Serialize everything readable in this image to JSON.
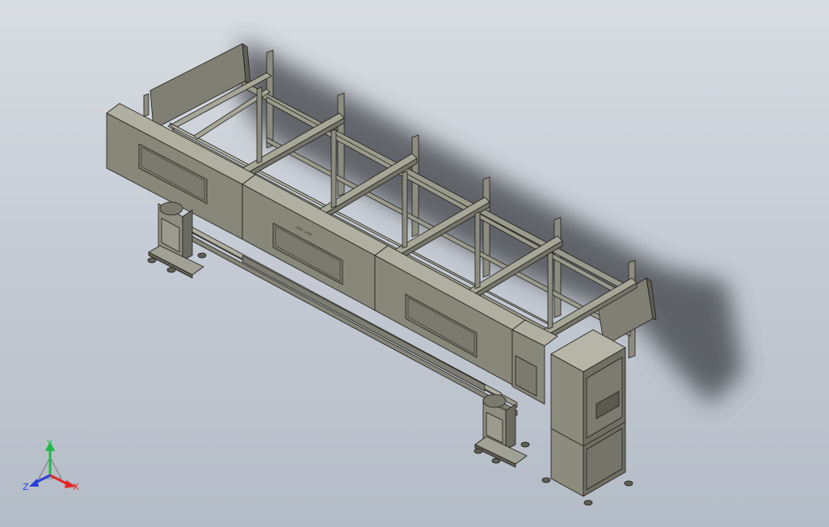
{
  "viewport": {
    "background_top": "#d9dde3",
    "background_bottom": "#b4bcc7"
  },
  "model": {
    "body_color": "#87877a",
    "body_light": "#a3a394",
    "body_dark": "#5f5f54",
    "edge_color": "#1e1e1a",
    "panel_text": "ANS ANK",
    "description_icons": [
      "bar-feeder-frame",
      "support-stand-left",
      "support-stand-right",
      "control-cabinet"
    ]
  },
  "triad": {
    "x_label": "X",
    "y_label": "Y",
    "z_label": "Z",
    "x_color": "#e22626",
    "y_color": "#22b84a",
    "z_color": "#2a3fd9"
  }
}
